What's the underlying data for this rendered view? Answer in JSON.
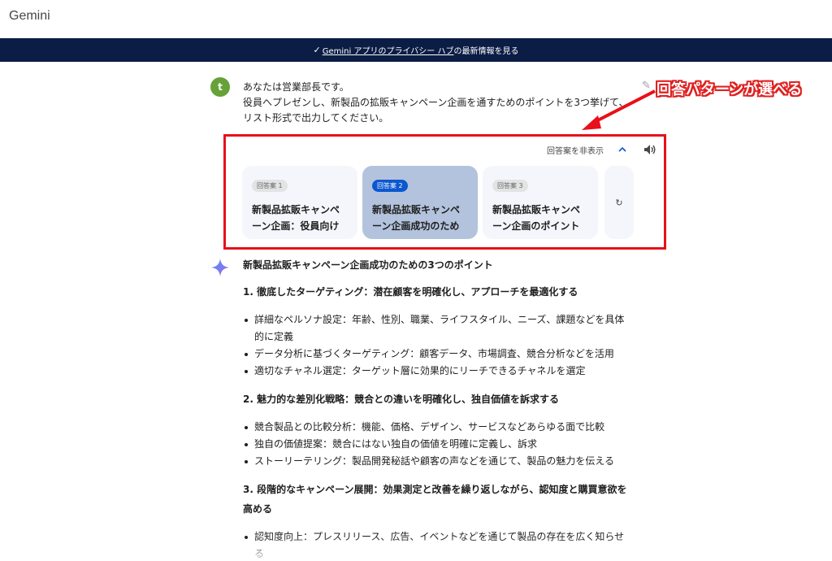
{
  "app": {
    "title": "Gemini"
  },
  "notice": {
    "prefix_link": "Gemini アプリのプライバシー ハブ",
    "suffix": "の最新情報を見る"
  },
  "user": {
    "initial": "t"
  },
  "prompt": {
    "lines": [
      "あなたは営業部長です。",
      "役員へプレゼンし、新製品の拡販キャンペーン企画を通すためのポイントを3つ挙げて、リスト形式で出力してください。"
    ]
  },
  "annotation": {
    "text": "回答パターンが選べる",
    "color": "#e8101a"
  },
  "drafts": {
    "hide_label": "回答案を非表示",
    "items": [
      {
        "badge": "回答案 1",
        "text": "新製品拡販キャンペーン企画：役員向け",
        "selected": false
      },
      {
        "badge": "回答案 2",
        "text": "新製品拡販キャンペーン企画成功のため",
        "selected": true
      },
      {
        "badge": "回答案 3",
        "text": "新製品拡販キャンペーン企画のポイント",
        "selected": false
      }
    ],
    "regenerate_icon": "refresh-icon"
  },
  "response": {
    "title": "新製品拡販キャンペーン企画成功のための3つのポイント",
    "sections": [
      {
        "heading": "1. 徹底したターゲティング：潜在顧客を明確化し、アプローチを最適化する",
        "bullets": [
          "詳細なペルソナ設定：年齢、性別、職業、ライフスタイル、ニーズ、課題などを具体的に定義",
          "データ分析に基づくターゲティング：顧客データ、市場調査、競合分析などを活用",
          "適切なチャネル選定：ターゲット層に効果的にリーチできるチャネルを選定"
        ]
      },
      {
        "heading": "2. 魅力的な差別化戦略：競合との違いを明確化し、独自価値を訴求する",
        "bullets": [
          "競合製品との比較分析：機能、価格、デザイン、サービスなどあらゆる面で比較",
          "独自の価値提案：競合にはない独自の価値を明確に定義し、訴求",
          "ストーリーテリング：製品開発秘話や顧客の声などを通じて、製品の魅力を伝える"
        ]
      },
      {
        "heading": "3. 段階的なキャンペーン展開：効果測定と改善を繰り返しながら、認知度と購買意欲を高める",
        "bullets": [
          "認知度向上：プレスリリース、広告、イベントなどを通じて製品の存在を広く知らせる"
        ]
      }
    ]
  },
  "colors": {
    "notice_bg": "#0b1d45",
    "accent": "#0b57d0",
    "selected_card": "#b3c3dd",
    "avatar": "#66a238"
  }
}
